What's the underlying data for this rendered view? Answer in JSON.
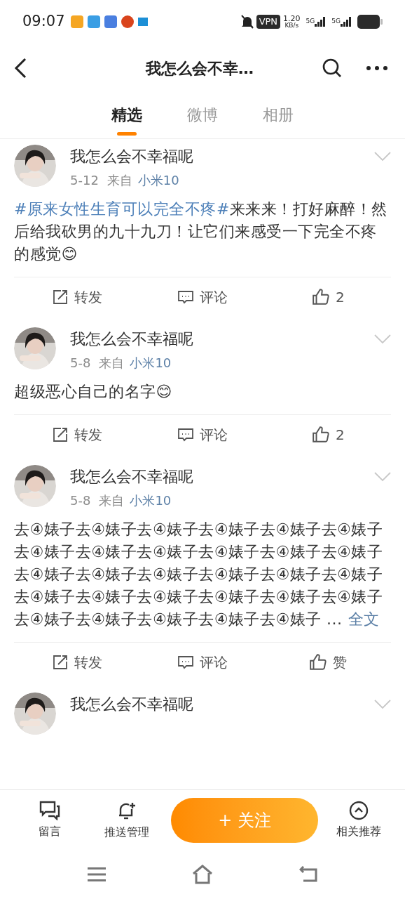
{
  "status_bar": {
    "time": "09:07",
    "vpn": "VPN",
    "speed": "1.20",
    "speed_unit": "KB/s",
    "networks": [
      "5G",
      "5G"
    ]
  },
  "nav": {
    "title": "我怎么会不幸…"
  },
  "tabs": [
    {
      "label": "精选",
      "selected": true
    },
    {
      "label": "微博",
      "selected": false
    },
    {
      "label": "相册",
      "selected": false
    }
  ],
  "posts": [
    {
      "author": "我怎么会不幸福呢",
      "date": "5-12",
      "source_prefix": "来自",
      "source": "小米10",
      "hashtag": "#原来女性生育可以完全不疼#",
      "text": "来来来！打好麻醉！然后给我砍男的九十九刀！让它们来感受一下完全不疼的感觉😊",
      "actions": [
        {
          "kind": "repost",
          "label": "转发"
        },
        {
          "kind": "comment",
          "label": "评论"
        },
        {
          "kind": "like",
          "label": "2"
        }
      ]
    },
    {
      "author": "我怎么会不幸福呢",
      "date": "5-8",
      "source_prefix": "来自",
      "source": "小米10",
      "text": "超级恶心自己的名字😊",
      "actions": [
        {
          "kind": "repost",
          "label": "转发"
        },
        {
          "kind": "comment",
          "label": "评论"
        },
        {
          "kind": "like",
          "label": "2"
        }
      ]
    },
    {
      "author": "我怎么会不幸福呢",
      "date": "5-8",
      "source_prefix": "来自",
      "source": "小米10",
      "text": "去④婊子去④婊子去④婊子去④婊子去④婊子去④婊子去④婊子去④婊子去④婊子去④婊子去④婊子去④婊子去④婊子去④婊子去④婊子去④婊子去④婊子去④婊子去④婊子去④婊子去④婊子去④婊子去④婊子去④婊子去④婊子去④婊子去④婊子去④婊子去④婊子 ...",
      "more": "全文",
      "actions": [
        {
          "kind": "repost",
          "label": "转发"
        },
        {
          "kind": "comment",
          "label": "评论"
        },
        {
          "kind": "like",
          "label": "赞"
        }
      ]
    },
    {
      "author": "我怎么会不幸福呢"
    }
  ],
  "bottom_bar": {
    "items": [
      {
        "kind": "message",
        "label": "留言"
      },
      {
        "kind": "bell",
        "label": "推送管理"
      }
    ],
    "follow_button": "+ 关注",
    "recommend": {
      "label": "相关推荐"
    }
  }
}
